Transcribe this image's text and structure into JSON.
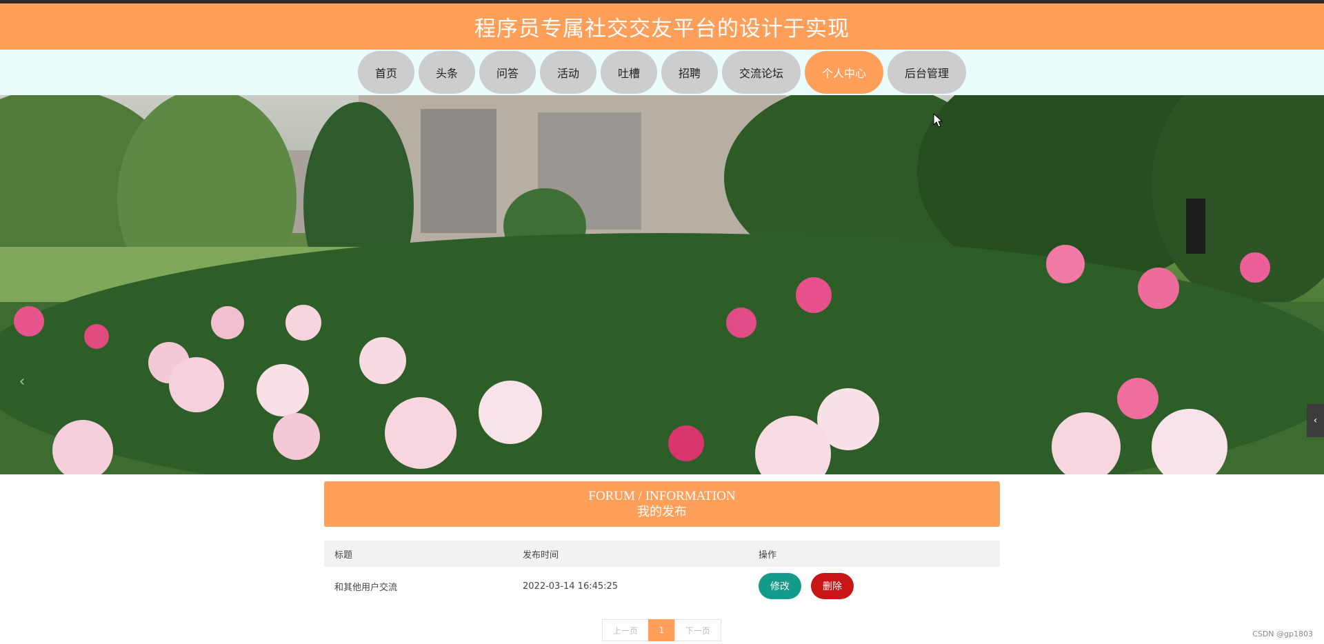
{
  "site_title": "程序员专属社交交友平台的设计于实现",
  "nav": [
    {
      "label": "首页"
    },
    {
      "label": "头条"
    },
    {
      "label": "问答"
    },
    {
      "label": "活动"
    },
    {
      "label": "吐槽"
    },
    {
      "label": "招聘"
    },
    {
      "label": "交流论坛"
    },
    {
      "label": "个人中心",
      "active": true
    },
    {
      "label": "后台管理"
    }
  ],
  "banner": {
    "prev_icon": "‹",
    "side_tab_icon": "‹",
    "slide_count": 3,
    "active_slide": 1
  },
  "section": {
    "title_en": "FORUM / INFORMATION",
    "title_zh": "我的发布"
  },
  "table": {
    "headers": [
      "标题",
      "发布时间",
      "操作"
    ],
    "rows": [
      {
        "title": "和其他用户交流",
        "time": "2022-03-14 16:45:25",
        "edit_label": "修改",
        "delete_label": "删除"
      }
    ]
  },
  "pagination": {
    "prev": "上一页",
    "current": "1",
    "next": "下一页"
  },
  "watermark": "CSDN @gp1803",
  "colors": {
    "accent": "#ff9f5a",
    "edit": "#129a8a",
    "delete": "#c81515",
    "nav_bg": "#e9fbfb"
  }
}
